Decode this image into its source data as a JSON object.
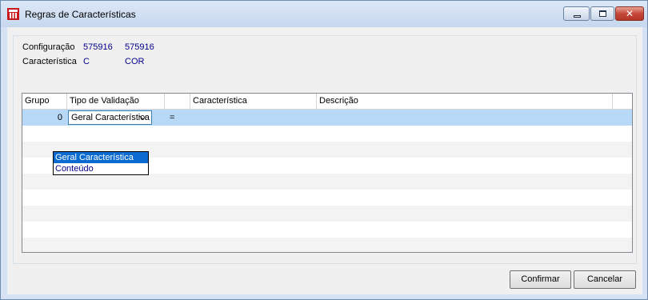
{
  "window": {
    "title": "Regras de Características",
    "icon": "app-logo-icon",
    "controls": [
      "minimize-icon",
      "maximize-icon",
      "close-icon"
    ],
    "close_glyph": "✕"
  },
  "info": {
    "configuracao": {
      "label": "Configuração",
      "value1": "575916",
      "value2": "575916"
    },
    "caracteristica": {
      "label": "Característica",
      "value1": "C",
      "value2": "COR"
    }
  },
  "grid": {
    "columns": [
      "Grupo",
      "Tipo de Validação",
      "",
      "Característica",
      "Descrição"
    ],
    "rows": [
      {
        "grupo": "0",
        "tipo": "Geral Característica",
        "op": "=",
        "caracteristica": "",
        "descricao": ""
      }
    ],
    "empty_rows": 8
  },
  "dropdown": {
    "options": [
      "Geral Característica",
      "Conteúdo"
    ],
    "selected": "Geral Característica"
  },
  "buttons": {
    "confirm": "Confirmar",
    "cancel": "Cancelar"
  },
  "colors": {
    "selected_row": "#b8d8f8",
    "value_text": "#00008b",
    "dropdown_highlight": "#0a6acf"
  }
}
